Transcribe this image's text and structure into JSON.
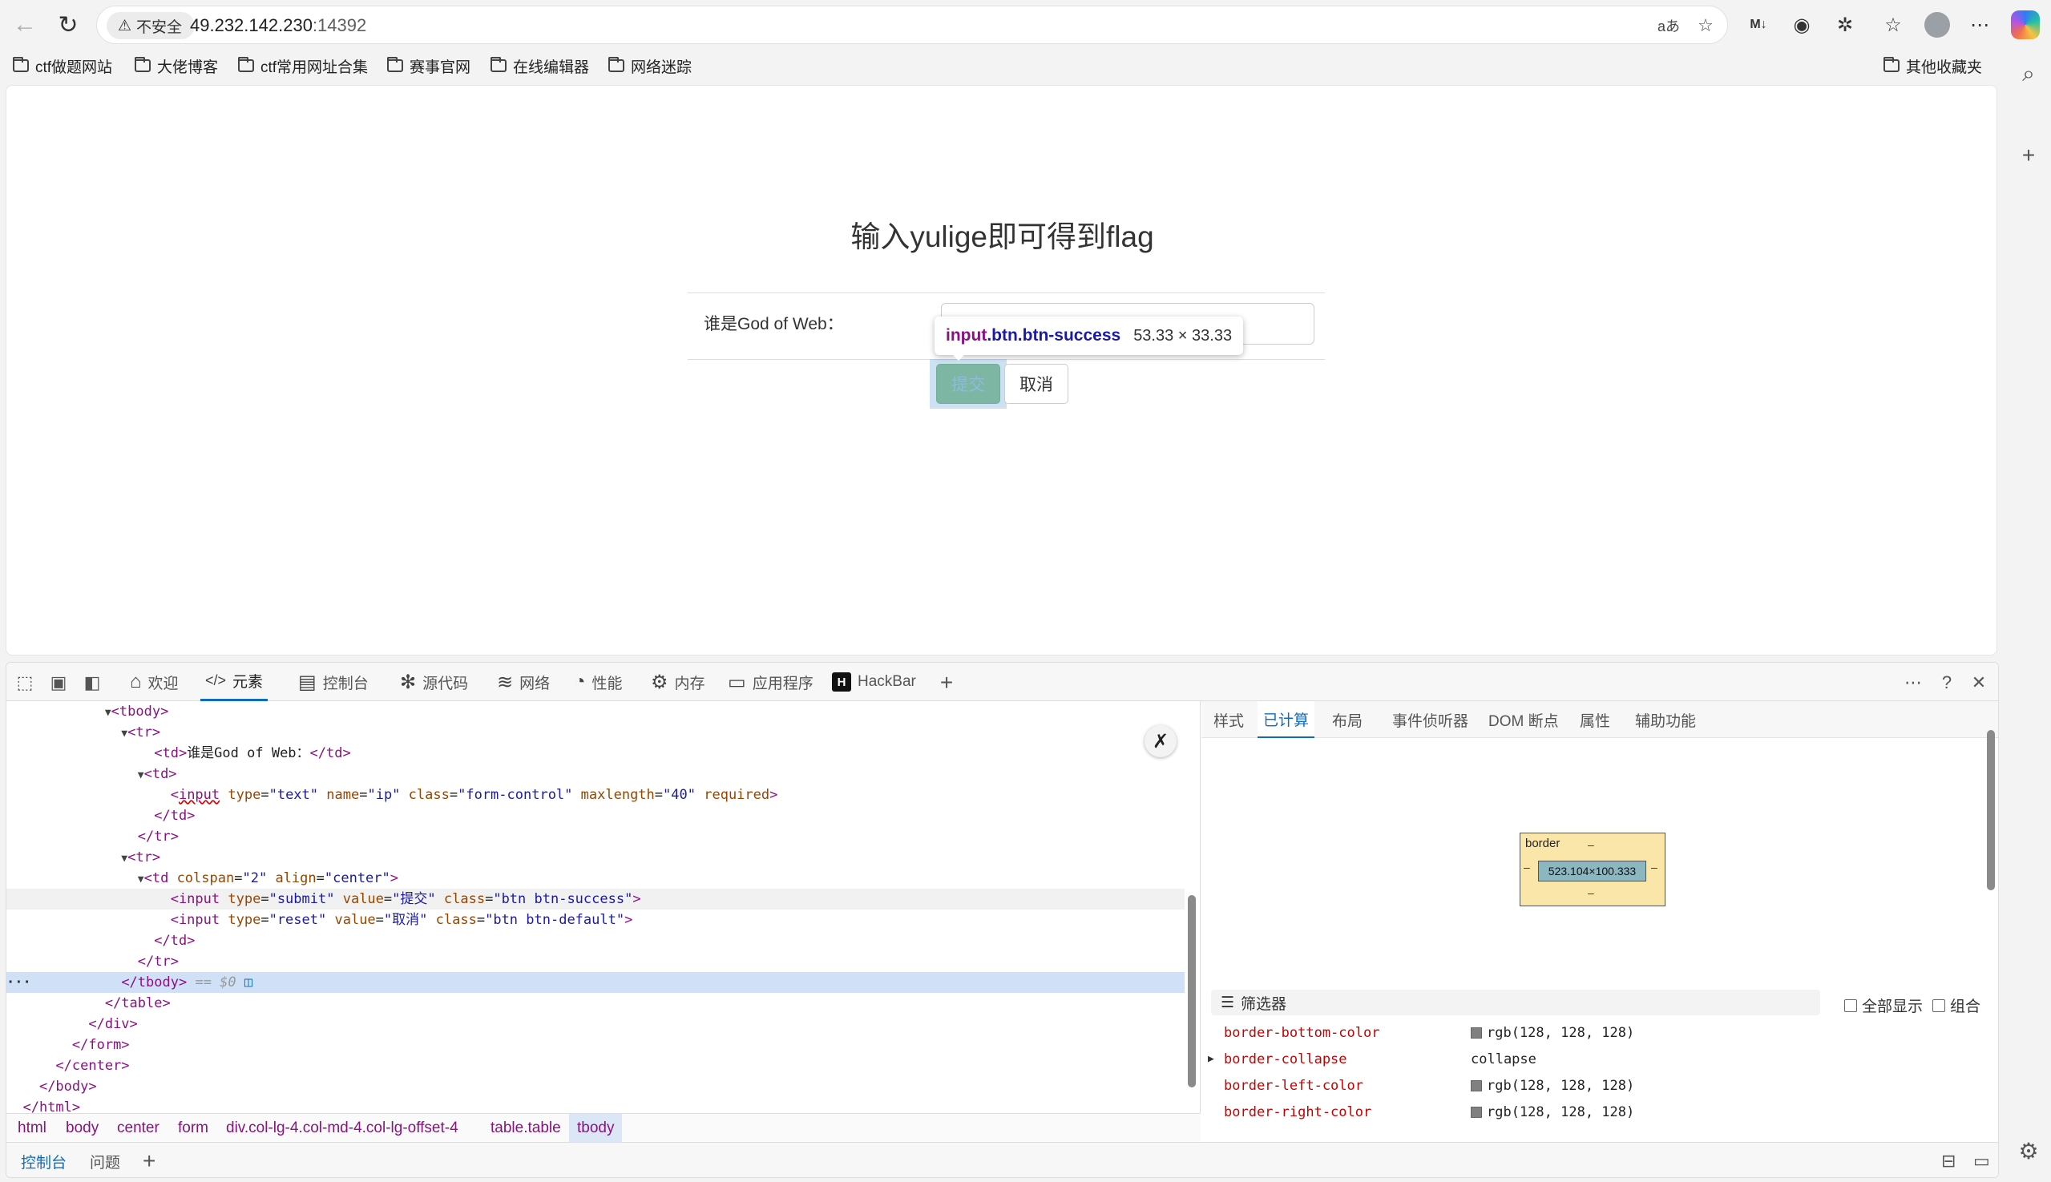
{
  "browser": {
    "security_label": "不安全",
    "url_host": "49.232.142.230",
    "url_port": ":14392",
    "read_aloud_icon_text": "aあ"
  },
  "bookmarks": {
    "items": [
      {
        "label": "ctf做题网站"
      },
      {
        "label": "大佬博客"
      },
      {
        "label": "ctf常用网址合集"
      },
      {
        "label": "赛事官网"
      },
      {
        "label": "在线编辑器"
      },
      {
        "label": "网络迷踪"
      }
    ],
    "other_label": "其他收藏夹"
  },
  "page": {
    "heading": "输入yulige即可得到flag",
    "field_label": "谁是God of Web：",
    "input_value": "",
    "submit_label": "提交",
    "reset_label": "取消"
  },
  "tooltip": {
    "tag": "input",
    "classes": ".btn.btn-success",
    "size": "53.33 × 33.33"
  },
  "devtools": {
    "tabs": [
      {
        "label": "欢迎",
        "icon": "home-icon"
      },
      {
        "label": "元素",
        "icon": "code-icon",
        "active": true
      },
      {
        "label": "控制台",
        "icon": "console-icon"
      },
      {
        "label": "源代码",
        "icon": "bug-icon"
      },
      {
        "label": "网络",
        "icon": "wifi-icon"
      },
      {
        "label": "性能",
        "icon": "gauge-icon"
      },
      {
        "label": "内存",
        "icon": "memory-icon"
      },
      {
        "label": "应用程序",
        "icon": "app-icon"
      },
      {
        "label": "HackBar",
        "icon": "hackbar-icon"
      }
    ],
    "dom": {
      "l1": "<tbody>",
      "l2": "<tr>",
      "l3_text": "谁是God of Web：",
      "l4": "<td>",
      "l5_attrs": [
        {
          "n": "type",
          "v": "\"text\""
        },
        {
          "n": "name",
          "v": "\"ip\""
        },
        {
          "n": "class",
          "v": "\"form-control\""
        },
        {
          "n": "maxlength",
          "v": "\"40\""
        },
        {
          "n": "required",
          "v": ""
        }
      ],
      "l6": "</td>",
      "l7": "</tr>",
      "l8": "<tr>",
      "l9_attrs": [
        {
          "n": "colspan",
          "v": "\"2\""
        },
        {
          "n": "align",
          "v": "\"center\""
        }
      ],
      "l10_attrs": [
        {
          "n": "type",
          "v": "\"submit\""
        },
        {
          "n": "value",
          "v": "\"提交\""
        },
        {
          "n": "class",
          "v": "\"btn btn-success\""
        }
      ],
      "l11_attrs": [
        {
          "n": "type",
          "v": "\"reset\""
        },
        {
          "n": "value",
          "v": "\"取消\""
        },
        {
          "n": "class",
          "v": "\"btn btn-default\""
        }
      ],
      "l12": "</td>",
      "l13": "</tr>",
      "l14": "</tbody>",
      "l14_ref": "== $0",
      "l15": "</table>",
      "l16": "</div>",
      "l17": "</form>",
      "l18": "</center>",
      "l19": "</body>",
      "l20": "</html>"
    },
    "breadcrumbs": [
      "html",
      "body",
      "center",
      "form",
      "div.col-lg-4.col-md-4.col-lg-offset-4",
      "table.table",
      "tbody"
    ],
    "styles_tabs": [
      "样式",
      "已计算",
      "布局",
      "事件侦听器",
      "DOM 断点",
      "属性",
      "辅助功能"
    ],
    "styles_active": "已计算",
    "boxmodel": {
      "label": "border",
      "dash": "–",
      "content": "523.104×100.333"
    },
    "filter_placeholder": "筛选器",
    "show_all_label": "全部显示",
    "group_label": "组合",
    "computed": [
      {
        "name": "border-bottom-color",
        "value": "rgb(128, 128, 128)",
        "swatch": "#808080"
      },
      {
        "name": "border-collapse",
        "value": "collapse",
        "expandable": true
      },
      {
        "name": "border-left-color",
        "value": "rgb(128, 128, 128)",
        "swatch": "#808080"
      },
      {
        "name": "border-right-color",
        "value": "rgb(128, 128, 128)",
        "swatch": "#808080"
      }
    ],
    "drawer_tabs": [
      "控制台",
      "问题"
    ]
  }
}
